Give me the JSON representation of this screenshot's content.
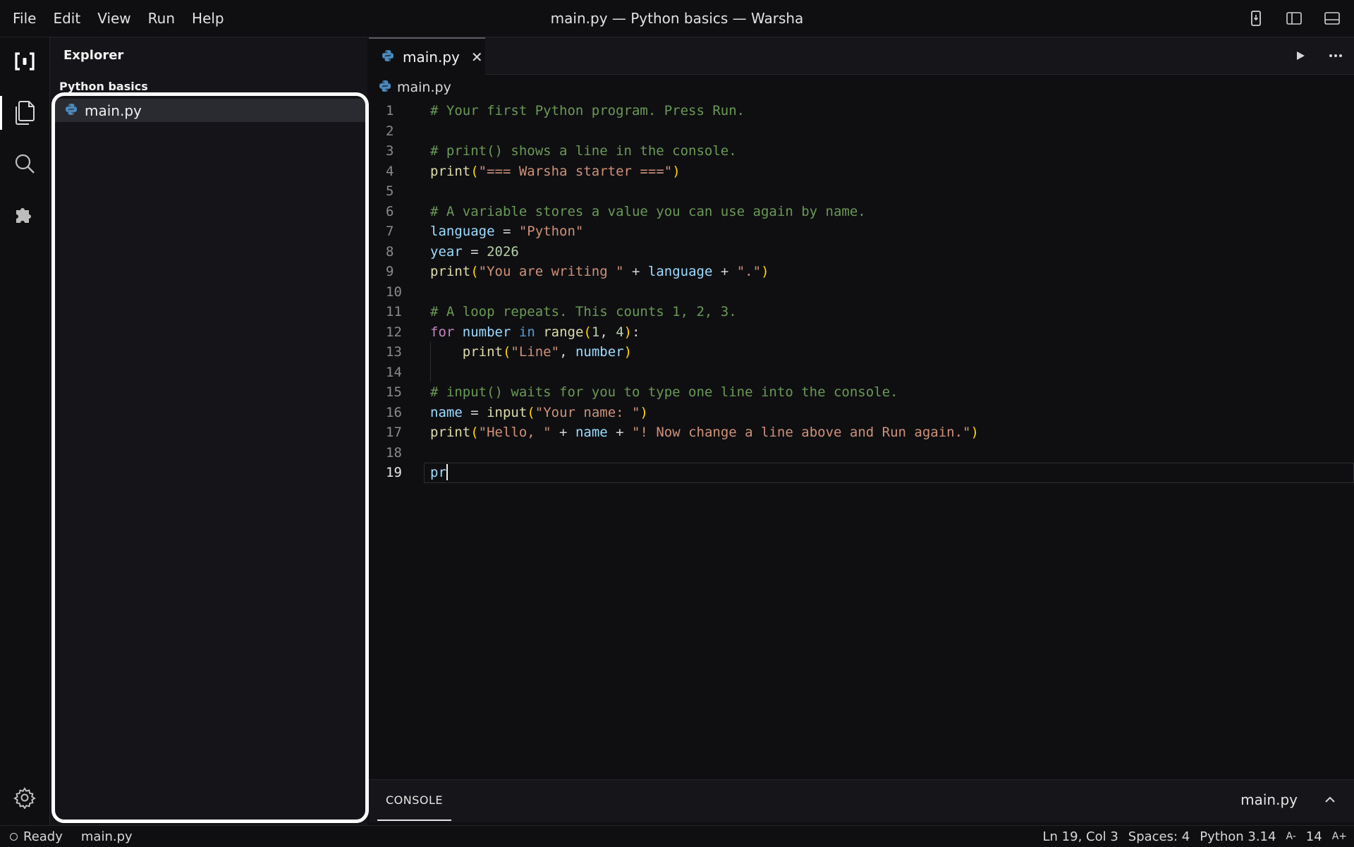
{
  "menu": [
    "File",
    "Edit",
    "View",
    "Run",
    "Help"
  ],
  "window_title": "main.py — Python basics — Warsha",
  "title_bar_icons": [
    "device-icon",
    "toggle-sidebar-icon",
    "toggle-panel-icon"
  ],
  "activity_bar": {
    "items": [
      "logo-icon",
      "files-icon",
      "search-icon",
      "extensions-icon"
    ],
    "active": "files-icon",
    "bottom": "gear-icon"
  },
  "explorer": {
    "title": "Explorer",
    "project": "Python basics",
    "files": [
      "main.py"
    ],
    "selected_file": "main.py"
  },
  "editor": {
    "tab_label": "main.py",
    "tab_close": "✕",
    "breadcrumb": "main.py",
    "action_icons": [
      "run-icon",
      "more-icon"
    ],
    "current_line": 19,
    "lines": [
      {
        "n": "1",
        "tokens": [
          {
            "t": "# Your first Python program. Press Run.",
            "c": "comment"
          }
        ]
      },
      {
        "n": "2",
        "tokens": []
      },
      {
        "n": "3",
        "tokens": [
          {
            "t": "# print() shows a line in the console.",
            "c": "comment"
          }
        ]
      },
      {
        "n": "4",
        "tokens": [
          {
            "t": "print",
            "c": "func"
          },
          {
            "t": "(",
            "c": "paren"
          },
          {
            "t": "\"=== Warsha starter ===\"",
            "c": "string"
          },
          {
            "t": ")",
            "c": "paren"
          }
        ]
      },
      {
        "n": "5",
        "tokens": []
      },
      {
        "n": "6",
        "tokens": [
          {
            "t": "# A variable stores a value you can use again by name.",
            "c": "comment"
          }
        ]
      },
      {
        "n": "7",
        "tokens": [
          {
            "t": "language",
            "c": "var"
          },
          {
            "t": " = ",
            "c": "plain"
          },
          {
            "t": "\"Python\"",
            "c": "string"
          }
        ]
      },
      {
        "n": "8",
        "tokens": [
          {
            "t": "year",
            "c": "var"
          },
          {
            "t": " = ",
            "c": "plain"
          },
          {
            "t": "2026",
            "c": "num"
          }
        ]
      },
      {
        "n": "9",
        "tokens": [
          {
            "t": "print",
            "c": "func"
          },
          {
            "t": "(",
            "c": "paren"
          },
          {
            "t": "\"You are writing \"",
            "c": "string"
          },
          {
            "t": " + ",
            "c": "plain"
          },
          {
            "t": "language",
            "c": "var"
          },
          {
            "t": " + ",
            "c": "plain"
          },
          {
            "t": "\".\"",
            "c": "string"
          },
          {
            "t": ")",
            "c": "paren"
          }
        ]
      },
      {
        "n": "10",
        "tokens": []
      },
      {
        "n": "11",
        "tokens": [
          {
            "t": "# A loop repeats. This counts 1, 2, 3.",
            "c": "comment"
          }
        ]
      },
      {
        "n": "12",
        "tokens": [
          {
            "t": "for",
            "c": "kw"
          },
          {
            "t": " ",
            "c": "plain"
          },
          {
            "t": "number",
            "c": "var"
          },
          {
            "t": " ",
            "c": "plain"
          },
          {
            "t": "in",
            "c": "kw2"
          },
          {
            "t": " ",
            "c": "plain"
          },
          {
            "t": "range",
            "c": "func"
          },
          {
            "t": "(",
            "c": "paren"
          },
          {
            "t": "1",
            "c": "num"
          },
          {
            "t": ", ",
            "c": "plain"
          },
          {
            "t": "4",
            "c": "num"
          },
          {
            "t": ")",
            "c": "paren"
          },
          {
            "t": ":",
            "c": "plain"
          }
        ]
      },
      {
        "n": "13",
        "indent": true,
        "tokens": [
          {
            "t": "    ",
            "c": "plain"
          },
          {
            "t": "print",
            "c": "func"
          },
          {
            "t": "(",
            "c": "paren"
          },
          {
            "t": "\"Line\"",
            "c": "string"
          },
          {
            "t": ", ",
            "c": "plain"
          },
          {
            "t": "number",
            "c": "var"
          },
          {
            "t": ")",
            "c": "paren"
          }
        ]
      },
      {
        "n": "14",
        "indent": true,
        "tokens": []
      },
      {
        "n": "15",
        "tokens": [
          {
            "t": "# input() waits for you to type one line into the console.",
            "c": "comment"
          }
        ]
      },
      {
        "n": "16",
        "tokens": [
          {
            "t": "name",
            "c": "var"
          },
          {
            "t": " = ",
            "c": "plain"
          },
          {
            "t": "input",
            "c": "func"
          },
          {
            "t": "(",
            "c": "paren"
          },
          {
            "t": "\"Your name: \"",
            "c": "string"
          },
          {
            "t": ")",
            "c": "paren"
          }
        ]
      },
      {
        "n": "17",
        "tokens": [
          {
            "t": "print",
            "c": "func"
          },
          {
            "t": "(",
            "c": "paren"
          },
          {
            "t": "\"Hello, \"",
            "c": "string"
          },
          {
            "t": " + ",
            "c": "plain"
          },
          {
            "t": "name",
            "c": "var"
          },
          {
            "t": " + ",
            "c": "plain"
          },
          {
            "t": "\"! Now change a line above and Run again.\"",
            "c": "string"
          },
          {
            "t": ")",
            "c": "paren"
          }
        ]
      },
      {
        "n": "18",
        "tokens": []
      },
      {
        "n": "19",
        "tokens": [
          {
            "t": "pr",
            "c": "var"
          }
        ]
      }
    ]
  },
  "console": {
    "tab_label": "CONSOLE",
    "file_label": "main.py",
    "toggle_icon": "chevron-up-icon"
  },
  "status": {
    "state": "Ready",
    "file": "main.py",
    "position": "Ln 19, Col 3",
    "spaces": "Spaces: 4",
    "language": "Python 3.14",
    "font_decrease": "A-",
    "font_size": "14",
    "font_increase": "A+"
  },
  "colors": {
    "background": "#0f0f12",
    "sidebar": "#151519",
    "selection": "#2a2b31",
    "comment": "#6a9955",
    "string": "#ce9178",
    "function": "#dcdcaa",
    "variable": "#9cdcfe",
    "keyword": "#c586c0",
    "python_icon": "#4b8bbe"
  }
}
